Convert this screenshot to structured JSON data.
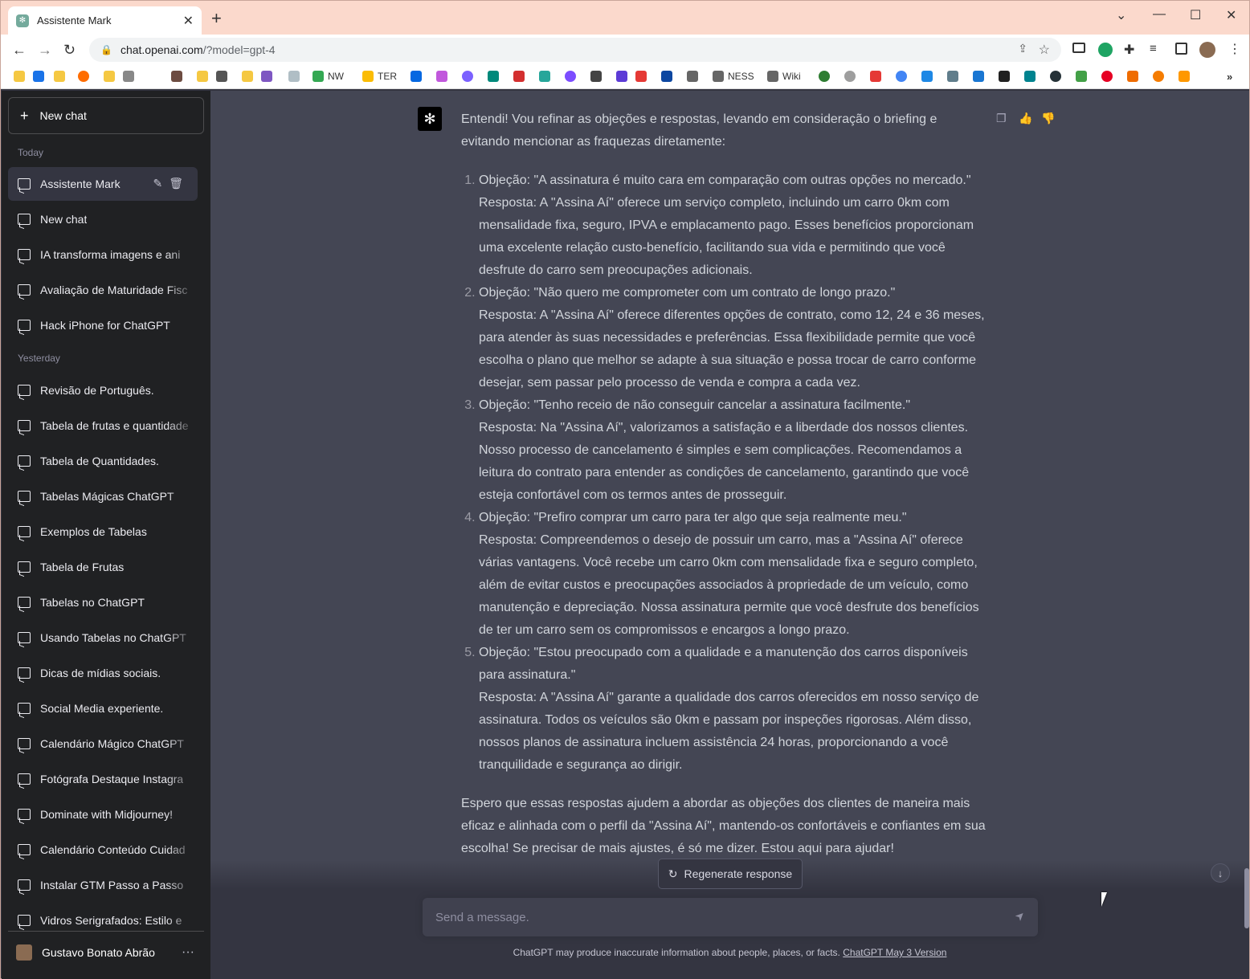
{
  "browser": {
    "tab_title": "Assistente Mark",
    "url_host": "chat.openai.com",
    "url_path": "/?model=gpt-4",
    "bookmarks": [
      "NW",
      "TER",
      "NESS",
      "Wiki"
    ]
  },
  "sidebar": {
    "new_chat": "New chat",
    "today_label": "Today",
    "yesterday_label": "Yesterday",
    "today": [
      "Assistente Mark",
      "New chat",
      "IA transforma imagens e ani",
      "Avaliação de Maturidade Fisc",
      "Hack iPhone for ChatGPT"
    ],
    "yesterday": [
      "Revisão de Português.",
      "Tabela de frutas e quantidade",
      "Tabela de Quantidades.",
      "Tabelas Mágicas ChatGPT",
      "Exemplos de Tabelas",
      "Tabela de Frutas",
      "Tabelas no ChatGPT",
      "Usando Tabelas no ChatGPT",
      "Dicas de mídias sociais.",
      "Social Media experiente.",
      "Calendário Mágico ChatGPT",
      "Fotógrafa Destaque Instagra",
      "Dominate with Midjourney!",
      "Calendário Conteúdo Cuidad",
      "Instalar GTM Passo a Passo",
      "Vidros Serigrafados: Estilo e"
    ],
    "user_name": "Gustavo Bonato Abrão"
  },
  "message": {
    "intro": "Entendi! Vou refinar as objeções e respostas, levando em consideração o briefing e evitando mencionar as fraquezas diretamente:",
    "items": [
      {
        "objection": "Objeção: \"A assinatura é muito cara em comparação com outras opções no mercado.\"",
        "response": "Resposta: A \"Assina Aí\" oferece um serviço completo, incluindo um carro 0km com mensalidade fixa, seguro, IPVA e emplacamento pago. Esses benefícios proporcionam uma excelente relação custo-benefício, facilitando sua vida e permitindo que você desfrute do carro sem preocupações adicionais."
      },
      {
        "objection": "Objeção: \"Não quero me comprometer com um contrato de longo prazo.\"",
        "response": "Resposta: A \"Assina Aí\" oferece diferentes opções de contrato, como 12, 24 e 36 meses, para atender às suas necessidades e preferências. Essa flexibilidade permite que você escolha o plano que melhor se adapte à sua situação e possa trocar de carro conforme desejar, sem passar pelo processo de venda e compra a cada vez."
      },
      {
        "objection": "Objeção: \"Tenho receio de não conseguir cancelar a assinatura facilmente.\"",
        "response": "Resposta: Na \"Assina Aí\", valorizamos a satisfação e a liberdade dos nossos clientes. Nosso processo de cancelamento é simples e sem complicações. Recomendamos a leitura do contrato para entender as condições de cancelamento, garantindo que você esteja confortável com os termos antes de prosseguir."
      },
      {
        "objection": "Objeção: \"Prefiro comprar um carro para ter algo que seja realmente meu.\"",
        "response": "Resposta: Compreendemos o desejo de possuir um carro, mas a \"Assina Aí\" oferece várias vantagens. Você recebe um carro 0km com mensalidade fixa e seguro completo, além de evitar custos e preocupações associados à propriedade de um veículo, como manutenção e depreciação. Nossa assinatura permite que você desfrute dos benefícios de ter um carro sem os compromissos e encargos a longo prazo."
      },
      {
        "objection": "Objeção: \"Estou preocupado com a qualidade e a manutenção dos carros disponíveis para assinatura.\"",
        "response": "Resposta: A \"Assina Aí\" garante a qualidade dos carros oferecidos em nosso serviço de assinatura. Todos os veículos são 0km e passam por inspeções rigorosas. Além disso, nossos planos de assinatura incluem assistência 24 horas, proporcionando a você tranquilidade e segurança ao dirigir."
      }
    ],
    "outro": "Espero que essas respostas ajudem a abordar as objeções dos clientes de maneira mais eficaz e alinhada com o perfil da \"Assina Aí\", mantendo-os confortáveis e confiantes em sua escolha! Se precisar de mais ajustes, é só me dizer. Estou aqui para ajudar!"
  },
  "composer": {
    "regenerate": "Regenerate response",
    "placeholder": "Send a message.",
    "disclaimer": "ChatGPT may produce inaccurate information about people, places, or facts.",
    "version_link": "ChatGPT May 3 Version"
  }
}
